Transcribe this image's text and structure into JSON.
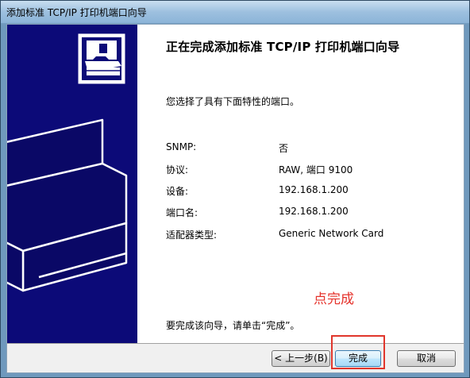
{
  "window": {
    "title": "添加标准 TCP/IP 打印机端口向导"
  },
  "wizard": {
    "heading": "正在完成添加标准 TCP/IP 打印机端口向导",
    "description": "您选择了具有下面特性的端口。",
    "properties": [
      {
        "label": "SNMP:",
        "value": "否"
      },
      {
        "label": "协议:",
        "value": "RAW, 端口 9100"
      },
      {
        "label": "设备:",
        "value": "192.168.1.200"
      },
      {
        "label": "端口名:",
        "value": "192.168.1.200"
      },
      {
        "label": "适配器类型:",
        "value": "Generic Network Card"
      }
    ],
    "annotation": "点完成",
    "footer": "要完成该向导，请单击“完成”。"
  },
  "buttons": {
    "back": "< 上一步(B)",
    "finish": "完成",
    "cancel": "取消"
  },
  "colors": {
    "side_panel": "#0c0a78",
    "annotation": "#e5322b",
    "highlight_border": "#e0362c"
  },
  "icons": {
    "wizard_graphic": "printer-graphic-icon"
  }
}
